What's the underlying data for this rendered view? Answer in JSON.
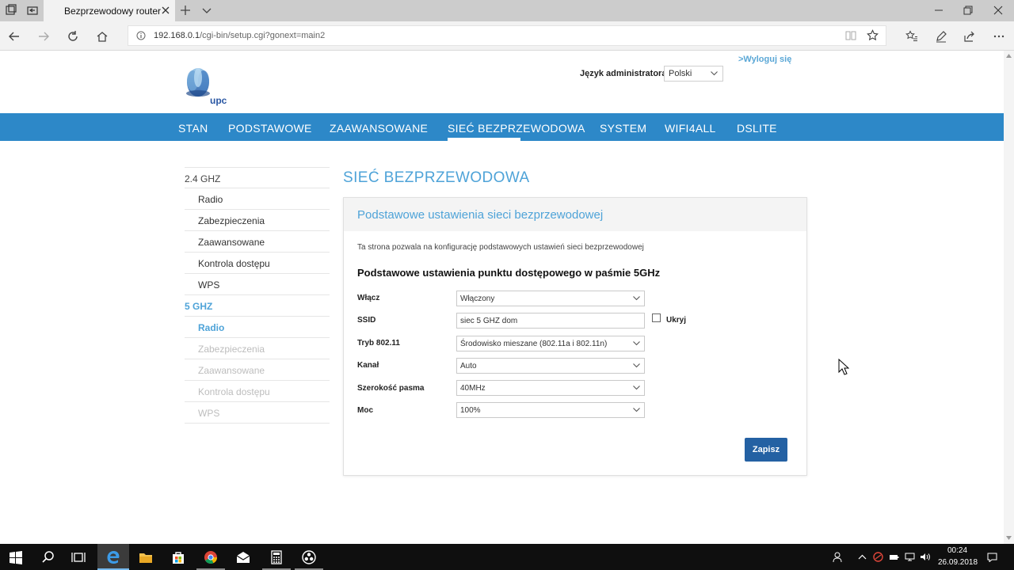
{
  "browser": {
    "tab_title": "Bezprzewodowy router",
    "url_host": "192.168.0.1",
    "url_path": "/cgi-bin/setup.cgi?gonext=main2"
  },
  "header": {
    "logo_text": "upc",
    "language_label": "Język administratora",
    "language_value": "Polski",
    "logout": ">Wyloguj się"
  },
  "menu": {
    "items": [
      {
        "label": "STAN",
        "active": false
      },
      {
        "label": "PODSTAWOWE",
        "active": false
      },
      {
        "label": "ZAAWANSOWANE",
        "active": false
      },
      {
        "label": "SIEĆ BEZPRZEWODOWA",
        "active": true
      },
      {
        "label": "SYSTEM",
        "active": false
      },
      {
        "label": "WIFI4ALL",
        "active": false
      },
      {
        "label": "DSLITE",
        "active": false
      }
    ]
  },
  "sidebar": {
    "groups": [
      {
        "label": "2.4 GHZ",
        "active": false,
        "items": [
          "Radio",
          "Zabezpieczenia",
          "Zaawansowane",
          "Kontrola dostępu",
          "WPS"
        ]
      },
      {
        "label": "5 GHZ",
        "active": true,
        "items": [
          "Radio",
          "Zabezpieczenia",
          "Zaawansowane",
          "Kontrola dostępu",
          "WPS"
        ],
        "active_item": "Radio"
      }
    ]
  },
  "page": {
    "heading": "SIEĆ BEZPRZEWODOWA",
    "panel_title": "Podstawowe ustawienia sieci bezprzewodowej",
    "description": "Ta strona pozwala na konfigurację podstawowych ustawień sieci bezprzewodowej",
    "section_title": "Podstawowe ustawienia punktu dostępowego w paśmie 5GHz",
    "fields": {
      "enable": {
        "label": "Włącz",
        "value": "Włączony"
      },
      "ssid": {
        "label": "SSID",
        "value": "siec 5 GHZ dom"
      },
      "hide": {
        "label": "Ukryj",
        "checked": false
      },
      "mode": {
        "label": "Tryb 802.11",
        "value": "Środowisko mieszane (802.11a i 802.11n)"
      },
      "channel": {
        "label": "Kanał",
        "value": "Auto"
      },
      "bandwidth": {
        "label": "Szerokość pasma",
        "value": "40MHz"
      },
      "power": {
        "label": "Moc",
        "value": "100%"
      }
    },
    "save_label": "Zapisz"
  },
  "taskbar": {
    "time": "00:24",
    "date": "26.09.2018"
  },
  "colors": {
    "nav_blue": "#2d88c8",
    "accent_blue": "#4ea3d8",
    "button_blue": "#2461a3",
    "taskbar": "#0f0f0f"
  }
}
